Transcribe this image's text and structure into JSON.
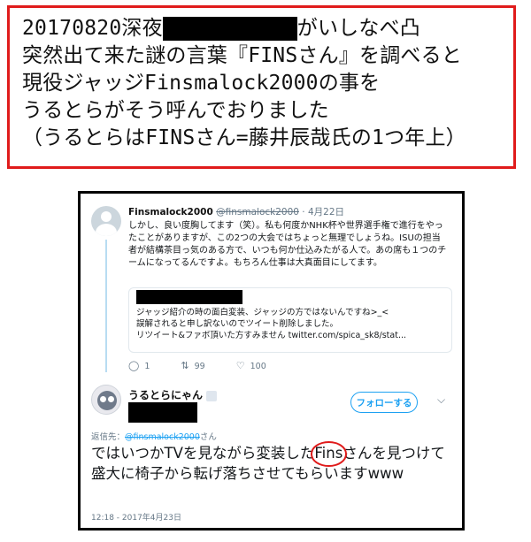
{
  "caption": {
    "line1_prefix": "20170820深夜",
    "line1_suffix": "がいしなべ凸",
    "line2": "突然出て来た謎の言葉『FINSさん』を調べると",
    "line3": "現役ジャッジFinsmalock2000の事を",
    "line4": "うるとらがそう呼んでおりました",
    "line5": "（うるとらはFINSさん=藤井辰哉氏の1つ年上）"
  },
  "tweet1": {
    "name": "Finsmalock2000",
    "handle": "@finsmalock2000",
    "date": "· 4月22日",
    "body": "しかし、良い度胸してます（笑）。私も何度かNHK杯や世界選手権で進行をやったことがありますが、この2つの大会ではちょっと無理でしょうね。ISUの担当者が結構茶目っ気のある方で、いつも何か仕込みたがる人で。あの席も１つのチームになってるんですよ。もちろん仕事は大真面目にしてます。",
    "quote": {
      "line1": "ジャッジ紹介の時の面白変装、ジャッジの方ではないんですね>_<",
      "line2": "誤解されると申し訳ないのでツイート削除しました。",
      "line3": "リツイート&ファボ頂いた方すみません twitter.com/spica_sk8/stat..."
    },
    "actions": {
      "reply_count": "1",
      "retweet_count": "99",
      "like_count": "100"
    }
  },
  "tweet2": {
    "name": "うるとらにゃん",
    "follow_label": "フォローする",
    "reply_label": "返信先：",
    "reply_handle": "@finsmalock2000",
    "reply_suffix": "さん",
    "body_before": "ではいつかTVを見ながら変装した",
    "body_circled": "Fins",
    "body_after": "さんを見つけて盛大に椅子から転げ落ちさせてもらいますwww",
    "time": "12:18 - 2017年4月23日"
  },
  "icons": {
    "reply": "reply-icon",
    "retweet": "retweet-icon",
    "like": "heart-icon",
    "more": "chevron-down-icon"
  },
  "colors": {
    "caption_border": "#e01b1b",
    "twitter_blue": "#1da1f2",
    "muted": "#657786",
    "circle_highlight": "#e01b1b"
  }
}
